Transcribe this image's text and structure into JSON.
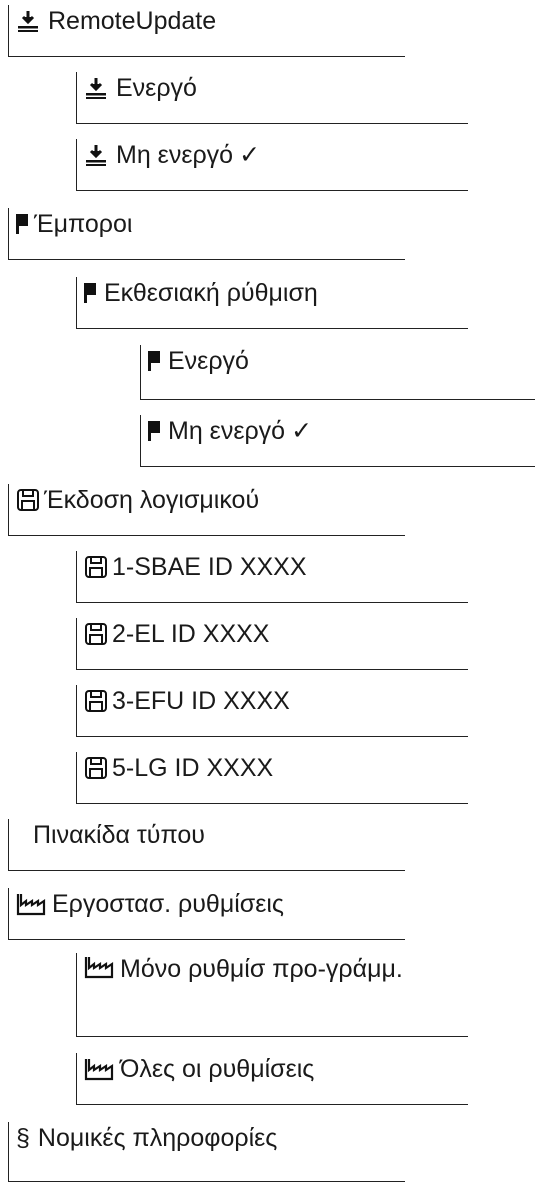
{
  "menu": {
    "remote_update": {
      "label": "RemoteUpdate",
      "icon": "download-icon"
    },
    "remote_update_on": {
      "label": "Ενεργό",
      "icon": "download-icon"
    },
    "remote_update_off": {
      "label": "Μη ενεργό",
      "icon": "download-icon",
      "check": "✓"
    },
    "dealers": {
      "label": "Έμποροι",
      "icon": "flag-icon"
    },
    "exhibition": {
      "label": "Εκθεσιακή ρύθμιση",
      "icon": "flag-icon"
    },
    "exhibition_on": {
      "label": "Ενεργό",
      "icon": "flag-icon"
    },
    "exhibition_off": {
      "label": "Μη ενεργό",
      "icon": "flag-icon",
      "check": "✓"
    },
    "software": {
      "label": "Έκδοση λογισμικού",
      "icon": "save-icon"
    },
    "sw1": {
      "label": "1-SBAE ID XXXX",
      "icon": "save-icon"
    },
    "sw2": {
      "label": "2-EL ID XXXX",
      "icon": "save-icon"
    },
    "sw3": {
      "label": "3-EFU ID XXXX",
      "icon": "save-icon"
    },
    "sw5": {
      "label": "5-LG ID XXXX",
      "icon": "save-icon"
    },
    "rating_plate": {
      "label": "Πινακίδα τύπου"
    },
    "factory": {
      "label": "Εργοστασ. ρυθμίσεις",
      "icon": "factory-icon"
    },
    "factory_prog": {
      "label": "Μόνο ρυθμίσ προ-γράμμ.",
      "icon": "factory-icon"
    },
    "factory_all": {
      "label": "Όλες οι ρυθμίσεις",
      "icon": "factory-icon"
    },
    "legal": {
      "label": "Νομικές πληροφορίες",
      "icon": "section-icon",
      "symbol": "§"
    }
  }
}
